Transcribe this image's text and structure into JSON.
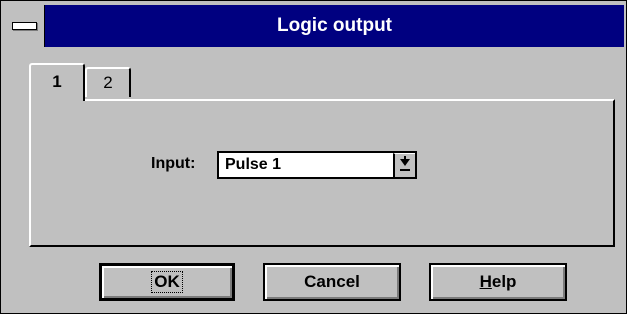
{
  "window": {
    "title": "Logic output"
  },
  "tabs": [
    {
      "label": "1",
      "active": true
    },
    {
      "label": "2",
      "active": false
    }
  ],
  "form": {
    "input_label": "Input:",
    "input_value": "Pulse 1"
  },
  "buttons": {
    "ok_label": "OK",
    "cancel_label": "Cancel",
    "help_mnemonic": "H",
    "help_rest": "elp"
  },
  "colors": {
    "titlebar": "#000080",
    "face": "#c0c0c0",
    "highlight": "#ffffff",
    "shadow": "#7b7b7b",
    "frame": "#000000"
  },
  "icons": {
    "system_menu": "system-menu-icon",
    "dropdown": "dropdown-arrow-icon"
  }
}
